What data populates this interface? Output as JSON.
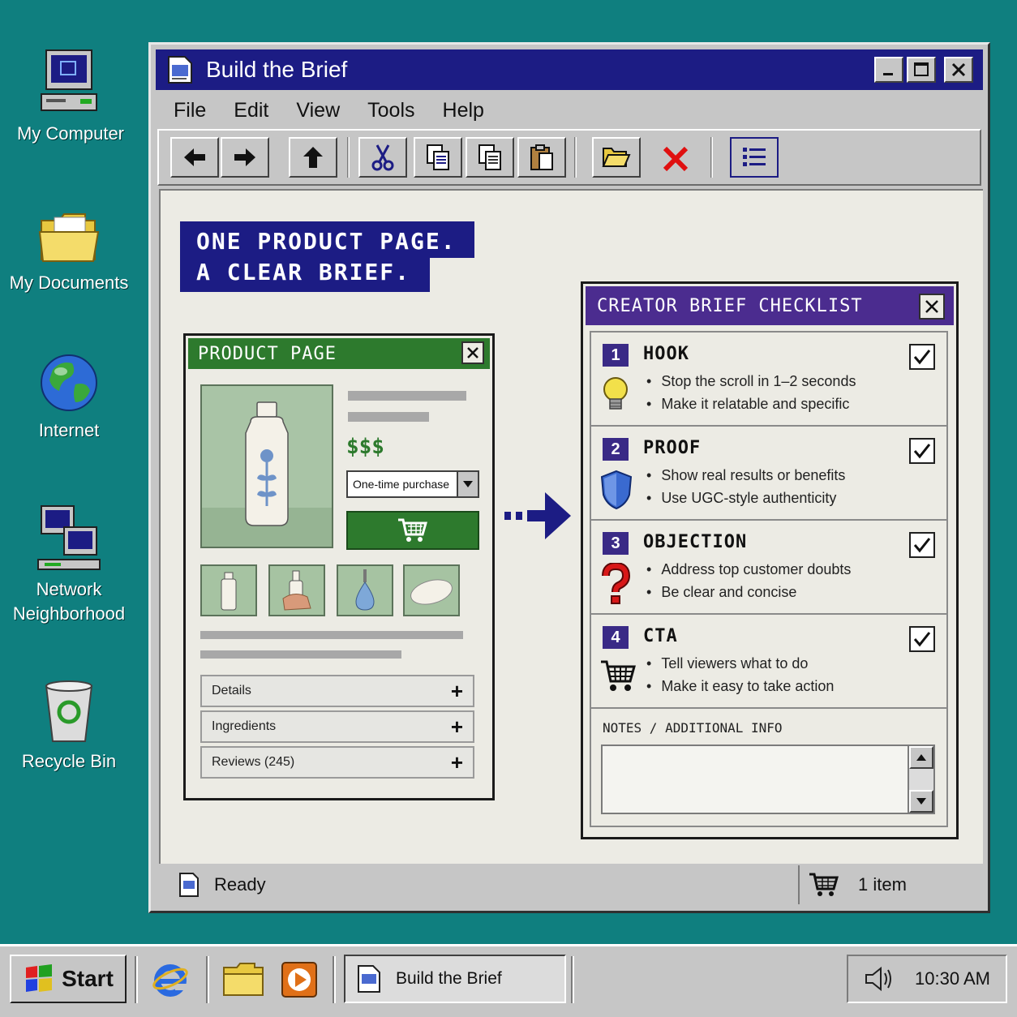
{
  "desktop": {
    "icons": [
      {
        "label": "My Computer"
      },
      {
        "label": "My Documents"
      },
      {
        "label": "Internet"
      },
      {
        "label": "Network Neighborhood"
      },
      {
        "label": "Recycle Bin"
      }
    ]
  },
  "window": {
    "title": "Build the Brief",
    "menu": [
      "File",
      "Edit",
      "View",
      "Tools",
      "Help"
    ],
    "toolbar_icons": [
      "back-arrow-icon",
      "forward-arrow-icon",
      "up-arrow-icon",
      "cut-icon",
      "copy-icon",
      "copy-alt-icon",
      "paste-icon",
      "open-folder-icon",
      "delete-icon",
      "list-view-icon"
    ]
  },
  "headline": {
    "line1": "ONE PRODUCT PAGE.",
    "line2": "A CLEAR BRIEF."
  },
  "product_page": {
    "title": "PRODUCT PAGE",
    "price": "$$$",
    "purchase_option": "One-time purchase",
    "accordions": [
      {
        "label": "Details"
      },
      {
        "label": "Ingredients"
      },
      {
        "label": "Reviews (245)"
      }
    ]
  },
  "checklist": {
    "title": "CREATOR BRIEF CHECKLIST",
    "sections": [
      {
        "num": "1",
        "title": "HOOK",
        "icon": "lightbulb-icon",
        "bullets": [
          "Stop the scroll in 1–2 seconds",
          "Make it relatable and specific"
        ],
        "checked": true
      },
      {
        "num": "2",
        "title": "PROOF",
        "icon": "shield-icon",
        "bullets": [
          "Show real results or benefits",
          "Use UGC-style authenticity"
        ],
        "checked": true
      },
      {
        "num": "3",
        "title": "OBJECTION",
        "icon": "question-mark-icon",
        "bullets": [
          "Address top customer doubts",
          "Be clear and concise"
        ],
        "checked": true
      },
      {
        "num": "4",
        "title": "CTA",
        "icon": "shopping-cart-icon",
        "bullets": [
          "Tell viewers what to do",
          "Make it easy to take action"
        ],
        "checked": true
      }
    ],
    "notes_label": "NOTES / ADDITIONAL INFO",
    "notes_value": ""
  },
  "statusbar": {
    "status": "Ready",
    "cart": "1 item"
  },
  "taskbar": {
    "start": "Start",
    "task": "Build the Brief",
    "time": "10:30 AM"
  },
  "colors": {
    "desktop": "#0f7f7f",
    "titlebar": "#1c1c84",
    "product_title": "#2d7a2d",
    "checklist_title": "#4b2c8f"
  }
}
